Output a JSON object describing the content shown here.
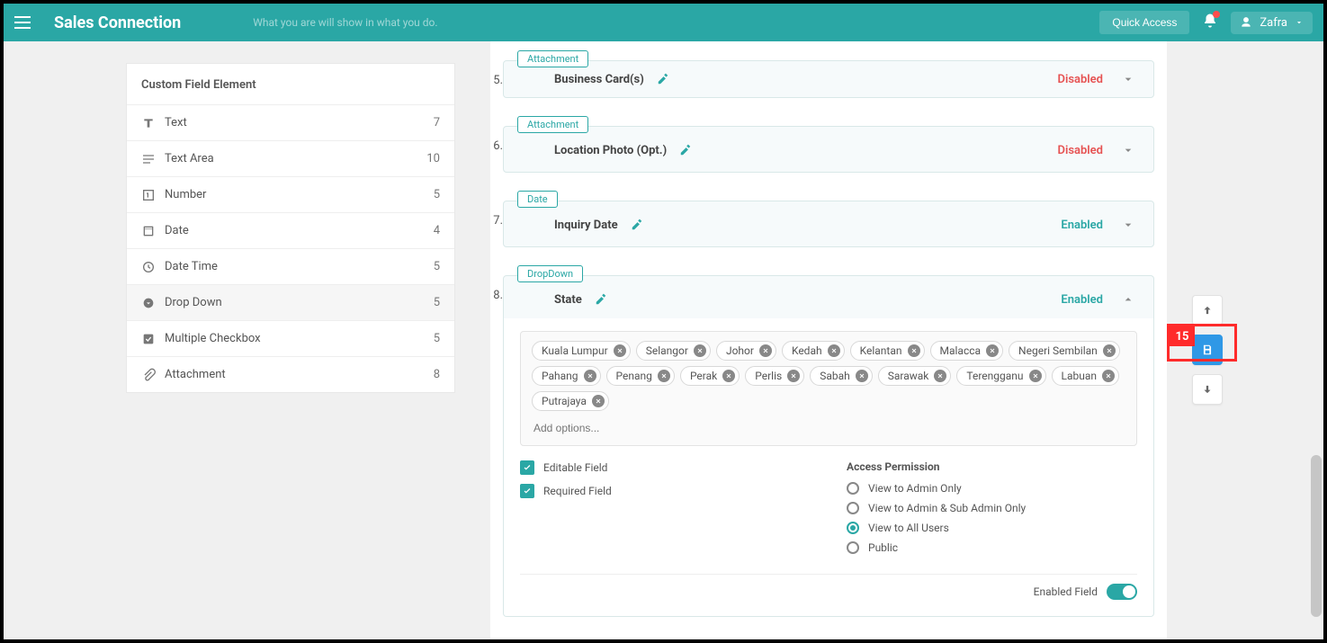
{
  "topbar": {
    "brand": "Sales Connection",
    "tagline": "What you are will show in what you do.",
    "quick_access": "Quick Access",
    "user_name": "Zafra"
  },
  "left_panel": {
    "title": "Custom Field Element",
    "items": [
      {
        "icon": "text",
        "label": "Text",
        "count": "7"
      },
      {
        "icon": "text-area",
        "label": "Text Area",
        "count": "10"
      },
      {
        "icon": "number",
        "label": "Number",
        "count": "5"
      },
      {
        "icon": "date",
        "label": "Date",
        "count": "4"
      },
      {
        "icon": "date-time",
        "label": "Date Time",
        "count": "5"
      },
      {
        "icon": "drop-down",
        "label": "Drop Down",
        "count": "5"
      },
      {
        "icon": "checkbox",
        "label": "Multiple Checkbox",
        "count": "5"
      },
      {
        "icon": "attachment",
        "label": "Attachment",
        "count": "8"
      }
    ]
  },
  "fields": [
    {
      "n": "5.",
      "type": "Attachment",
      "title": "Business Card(s)",
      "status": "Disabled"
    },
    {
      "n": "6.",
      "type": "Attachment",
      "title": "Location Photo (Opt.)",
      "status": "Disabled"
    },
    {
      "n": "7.",
      "type": "Date",
      "title": "Inquiry Date",
      "status": "Enabled"
    },
    {
      "n": "8.",
      "type": "DropDown",
      "title": "State",
      "status": "Enabled"
    }
  ],
  "dropdown": {
    "options": [
      "Kuala Lumpur",
      "Selangor",
      "Johor",
      "Kedah",
      "Kelantan",
      "Malacca",
      "Negeri Sembilan",
      "Pahang",
      "Penang",
      "Perak",
      "Perlis",
      "Sabah",
      "Sarawak",
      "Terengganu",
      "Labuan",
      "Putrajaya"
    ],
    "add_placeholder": "Add options...",
    "editable_label": "Editable Field",
    "required_label": "Required Field",
    "perm_title": "Access Permission",
    "perm_options": [
      "View to Admin Only",
      "View to Admin & Sub Admin Only",
      "View to All Users",
      "Public"
    ],
    "perm_selected": 2,
    "toggle_label": "Enabled Field"
  },
  "callout_number": "15"
}
